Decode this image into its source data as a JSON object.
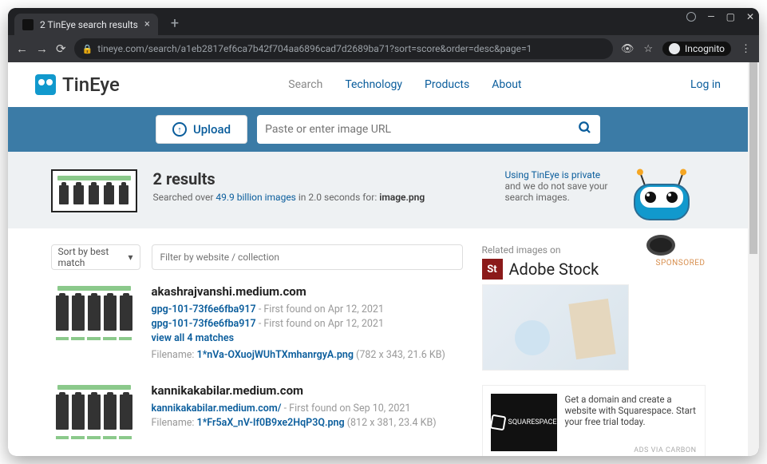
{
  "browser": {
    "tab_title": "2 TinEye search results",
    "url_display": "tineye.com/search/a1eb2817ef6ca7b42f704aa6896cad7d2689ba71?sort=score&order=desc&page=1",
    "incognito_label": "Incognito"
  },
  "header": {
    "brand": "TinEye",
    "nav": {
      "search": "Search",
      "technology": "Technology",
      "products": "Products",
      "about": "About"
    },
    "login": "Log in"
  },
  "searchbar": {
    "upload_label": "Upload",
    "url_placeholder": "Paste or enter image URL"
  },
  "summary": {
    "results_heading": "2 results",
    "searched_prefix": "Searched over ",
    "index_size": "49.9 billion images",
    "time_phrase": " in 2.0 seconds for: ",
    "query_filename": "image.png",
    "privacy_line1": "Using TinEye is private",
    "privacy_line2": "and we do not save your",
    "privacy_line3": "search images."
  },
  "controls": {
    "sort_label": "Sort by best match",
    "filter_placeholder": "Filter by website / collection"
  },
  "results": [
    {
      "domain": "akashrajvanshi.medium.com",
      "links": [
        {
          "text": "gpg-101-73f6e6fba917",
          "found": "First found on Apr 12, 2021"
        },
        {
          "text": "gpg-101-73f6e6fba917",
          "found": "First found on Apr 12, 2021"
        }
      ],
      "view_all": "view all 4 matches",
      "filename_label": "Filename: ",
      "filename": "1*nVa-OXuojWUhTXmhanrgyA.png",
      "meta": " (782 x 343, 21.6 KB)"
    },
    {
      "domain": "kannikakabilar.medium.com",
      "links": [
        {
          "text": "kannikakabilar.medium.com/",
          "found": "First found on Sep 10, 2021"
        }
      ],
      "filename_label": "Filename: ",
      "filename": "1*Fr5aX_nV-If0B9xe2HqP3Q.png",
      "meta": " (812 x 381, 23.4 KB)"
    }
  ],
  "sidebar": {
    "related_label": "Related images on",
    "adobe_label": "Adobe Stock",
    "sponsored": "SPONSORED",
    "carbon_text": "Get a domain and create a website with Squarespace. Start your free trial today.",
    "carbon_via": "ADS VIA CARBON",
    "squarespace": "SQUARESPACE"
  }
}
